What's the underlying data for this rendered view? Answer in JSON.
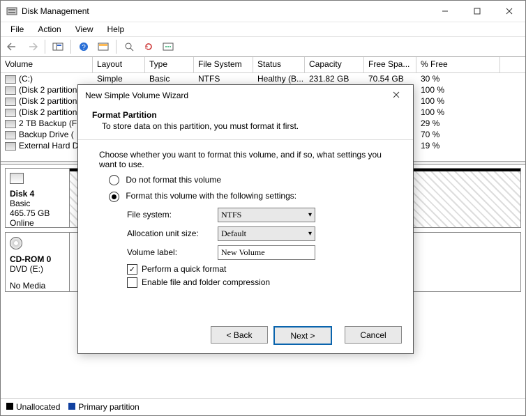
{
  "window": {
    "title": "Disk Management"
  },
  "menubar": {
    "file": "File",
    "action": "Action",
    "view": "View",
    "help": "Help"
  },
  "columns": {
    "volume": "Volume",
    "layout": "Layout",
    "type": "Type",
    "fs": "File System",
    "status": "Status",
    "capacity": "Capacity",
    "free": "Free Spa...",
    "pct": "% Free"
  },
  "volumes": [
    {
      "name": "(C:)",
      "layout": "Simple",
      "type": "Basic",
      "fs": "NTFS",
      "status": "Healthy (B...",
      "capacity": "231.82 GB",
      "free": "70.54 GB",
      "pct": "30 %"
    },
    {
      "name": "(Disk 2 partition",
      "layout": "",
      "type": "",
      "fs": "",
      "status": "",
      "capacity": "",
      "free": "",
      "pct": "100 %"
    },
    {
      "name": "(Disk 2 partition",
      "layout": "",
      "type": "",
      "fs": "",
      "status": "",
      "capacity": "",
      "free": "",
      "pct": "100 %"
    },
    {
      "name": "(Disk 2 partition",
      "layout": "",
      "type": "",
      "fs": "",
      "status": "",
      "capacity": "",
      "free": "",
      "pct": "100 %"
    },
    {
      "name": "2 TB Backup (F",
      "layout": "",
      "type": "",
      "fs": "",
      "status": "",
      "capacity": "",
      "free": "",
      "pct": "29 %"
    },
    {
      "name": "Backup Drive (",
      "layout": "",
      "type": "",
      "fs": "",
      "status": "",
      "capacity": "",
      "free": "",
      "pct": "70 %"
    },
    {
      "name": "External Hard D",
      "layout": "",
      "type": "",
      "fs": "",
      "status": "",
      "capacity": "",
      "free": "",
      "pct": "19 %"
    }
  ],
  "disks": {
    "d4": {
      "title": "Disk 4",
      "type": "Basic",
      "size": "465.75 GB",
      "state": "Online"
    },
    "cd": {
      "title": "CD-ROM 0",
      "type": "DVD (E:)",
      "state": "No Media"
    }
  },
  "legend": {
    "unalloc": "Unallocated",
    "primary": "Primary partition"
  },
  "wizard": {
    "title": "New Simple Volume Wizard",
    "heading": "Format Partition",
    "subheading": "To store data on this partition, you must format it first.",
    "prompt": "Choose whether you want to format this volume, and if so, what settings you want to use.",
    "option_noformat": "Do not format this volume",
    "option_format": "Format this volume with the following settings:",
    "lbl_fs": "File system:",
    "val_fs": "NTFS",
    "lbl_alloc": "Allocation unit size:",
    "val_alloc": "Default",
    "lbl_label": "Volume label:",
    "val_label": "New Volume",
    "cb_quick": "Perform a quick format",
    "cb_compress": "Enable file and folder compression",
    "btn_back": "< Back",
    "btn_next": "Next >",
    "btn_cancel": "Cancel"
  }
}
